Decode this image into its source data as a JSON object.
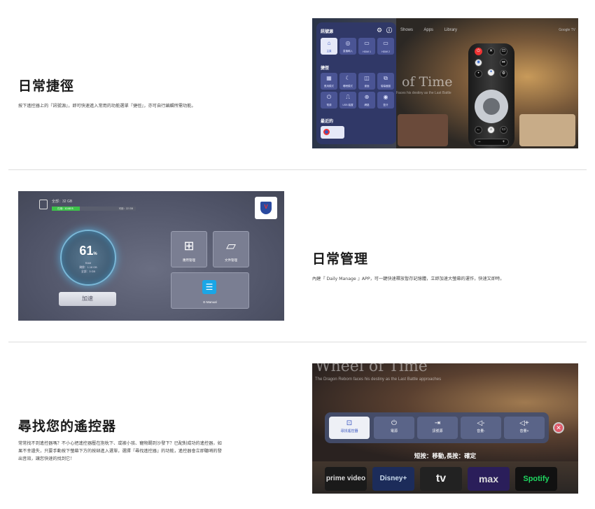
{
  "sections": [
    {
      "title": "日常捷徑",
      "desc": "按下遙控器上的『訊號源』，即可快速進入常用的功能選單『捷徑』，亦可自行編輯所需功能。"
    },
    {
      "title": "日常管理",
      "desc": "內建『 Daily Manage 』APP，可一鍵快速釋放暫存記憶體，立即加速大螢幕的運作，快速又即時。"
    },
    {
      "title": "尋找您的遙控器",
      "desc_lines": [
        "常常找不到遙控器嗎？不小心把遙控器壓在抱枕下、或被小孩、寵物踢到沙發下？已配對成功的遙控器，如",
        "果不幸遺失，只要手動按下螢幕下方的按鈕進入選單，選擇『尋找遙控器』的功能，遙控器會立即聽哨的發",
        "出音效，讓您快速的找到它！"
      ]
    }
  ],
  "shot1": {
    "nav": [
      "Shows",
      "Apps",
      "Library"
    ],
    "google_tv": "Google TV",
    "hero_title": "of Time",
    "hero_sub": "Faces his destiny as the Last Battle",
    "panel_source_title": "訊號源",
    "sources": [
      {
        "glyph": "⌂",
        "label": "主頁"
      },
      {
        "glyph": "◎",
        "label": "直播輸入"
      },
      {
        "glyph": "▭",
        "label": "HDMI 1"
      },
      {
        "glyph": "▭",
        "label": "HDMI 2"
      }
    ],
    "panel_shortcut_title": "捷徑",
    "shortcuts": [
      {
        "glyph": "▦",
        "label": "應用模式"
      },
      {
        "glyph": "☾",
        "label": "睡眠模式"
      },
      {
        "glyph": "◫",
        "label": "畫面"
      },
      {
        "glyph": "⧉",
        "label": "螢幕截圖"
      },
      {
        "glyph": "⏻",
        "label": "電源"
      },
      {
        "glyph": "⎍",
        "label": "USB 裝置"
      },
      {
        "glyph": "⊕",
        "label": "網路"
      },
      {
        "glyph": "◉",
        "label": "藍牙"
      }
    ],
    "panel_recent_title": "最近的",
    "remote_buttons": [
      "⏻",
      "✕",
      "⊡",
      "◉",
      "⏯",
      "•",
      "✦",
      "⚙"
    ],
    "remote_bar": [
      "−",
      "+"
    ]
  },
  "shot2": {
    "storage_total": "全部：32 GB",
    "storage_used": "已用：10.68 B",
    "storage_free": "可用：22 GB",
    "storage_used_fraction": 0.33,
    "ram_pct": "61",
    "ram_unit": "%",
    "ram_label": "RAM",
    "ram_free": "剩餘：1.18 GB",
    "ram_total": "全部：3 GB",
    "accel_button": "加速",
    "tiles": [
      {
        "glyph": "⊞",
        "label": "應用管理"
      },
      {
        "glyph": "▱",
        "label": "文件管理"
      }
    ],
    "emanual": "E-Manual",
    "logo_letter": "V"
  },
  "shot3": {
    "hero_title": "Wheel of Time",
    "hero_sub": "The Dragon Reborn faces his destiny as the Last Battle approaches",
    "buttons": [
      {
        "glyph": "⊡",
        "label": "尋找遙控器"
      },
      {
        "glyph": "⏻",
        "label": "電源"
      },
      {
        "glyph": "⇥",
        "label": "訊號源"
      },
      {
        "glyph": "◁-",
        "label": "音量-"
      },
      {
        "glyph": "◁+",
        "label": "音量+"
      }
    ],
    "close": "✕",
    "hint": "短按：移動,長按：確定",
    "services": [
      "prime video",
      "Disney+",
      "tv",
      "max",
      "Spotify"
    ]
  }
}
